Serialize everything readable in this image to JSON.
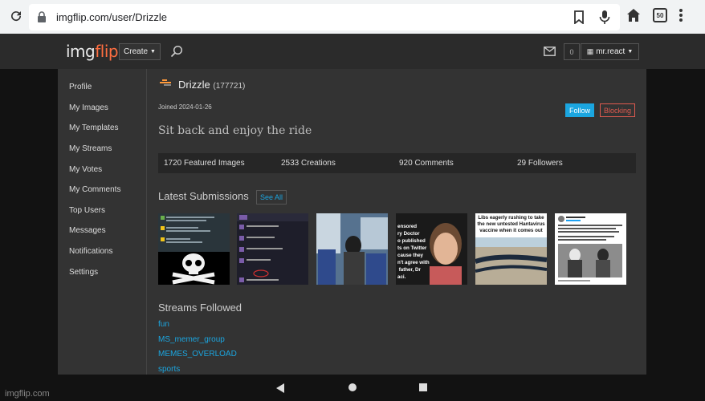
{
  "browser": {
    "url": "imgflip.com/user/Drizzle",
    "tab_count": "50"
  },
  "header": {
    "logo_img": "img",
    "logo_flip": "flip",
    "create_label": "Create",
    "notif_count": "0",
    "username": "mr.react"
  },
  "sidebar": {
    "items": [
      {
        "label": "Profile"
      },
      {
        "label": "My Images"
      },
      {
        "label": "My Templates"
      },
      {
        "label": "My Streams"
      },
      {
        "label": "My Votes"
      },
      {
        "label": "My Comments"
      },
      {
        "label": "Top Users"
      },
      {
        "label": "Messages"
      },
      {
        "label": "Notifications"
      },
      {
        "label": "Settings"
      }
    ]
  },
  "profile": {
    "name": "Drizzle",
    "points": "(177721)",
    "joined": "Joined 2024-01-26",
    "follow_label": "Follow",
    "blocking_label": "Blocking",
    "tagline": "Sit back and enjoy the ride"
  },
  "stats": {
    "featured": "1720 Featured Images",
    "creations": "2533 Creations",
    "comments": "920 Comments",
    "followers": "29 Followers"
  },
  "latest": {
    "title": "Latest Submissions",
    "see_all": "See All",
    "thumb4_text": "ensored\nry Doctor\no published\nts on Twitter\ncause they\nn't agree with\n father, Dr\naci.",
    "thumb5_text": "Libs eagerly rushing to take the new untested Hantavirus vaccine when it comes out"
  },
  "streams": {
    "title": "Streams Followed",
    "items": [
      {
        "label": "fun"
      },
      {
        "label": "MS_memer_group"
      },
      {
        "label": "MEMES_OVERLOAD"
      },
      {
        "label": "sports"
      }
    ]
  },
  "watermark": "imgflip.com",
  "colors": {
    "accent": "#1ba6e0",
    "blocking": "#e05a4f",
    "brand": "#ff6e40"
  }
}
